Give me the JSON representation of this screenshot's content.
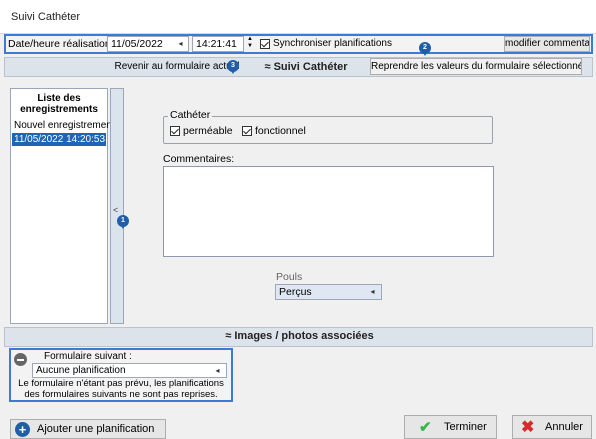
{
  "window": {
    "title": "Suivi Cathéter"
  },
  "toprow": {
    "date_label": "Date/heure réalisation",
    "date_value": "11/05/2022",
    "time_value": "14:21:41",
    "sync_label": "Synchroniser planifications",
    "modify_comment_button": "modifier commentaire ..."
  },
  "navbar": {
    "back_button": "Revenir au formulaire actuel",
    "section_title": "Suivi Cathéter",
    "reprendre_button": "Reprendre les valeurs du formulaire sélectionné",
    "badge_back": "3",
    "badge_reprendre": "2"
  },
  "records": {
    "header": "Liste des enregistrements",
    "items": [
      "Nouvel enregistrement",
      "11/05/2022 14:20:53"
    ],
    "splitter_badge": "1",
    "splitter_arrow": "<"
  },
  "form": {
    "catheter_group": "Cathéter",
    "permeable_label": "perméable",
    "fonctionnel_label": "fonctionnel",
    "comments_label": "Commentaires:",
    "comments_value": "",
    "pouls_label": "Pouls",
    "pouls_value": "Perçus"
  },
  "images_bar": {
    "label": "Images / photos associées"
  },
  "next_form": {
    "label": "Formulaire suivant :",
    "value": "Aucune planification",
    "note": "Le formulaire n'étant pas prévu, les planifications des formulaires suivants ne sont pas reprises."
  },
  "footer": {
    "add_button": "Ajouter une planification",
    "finish_button": "Terminer",
    "cancel_button": "Annuler"
  },
  "colors": {
    "accent": "#3a7bd5",
    "selection": "#1e66b5",
    "badge": "#1f5fa8",
    "green_check": "#3bb54a",
    "red_x": "#d62b2b"
  }
}
